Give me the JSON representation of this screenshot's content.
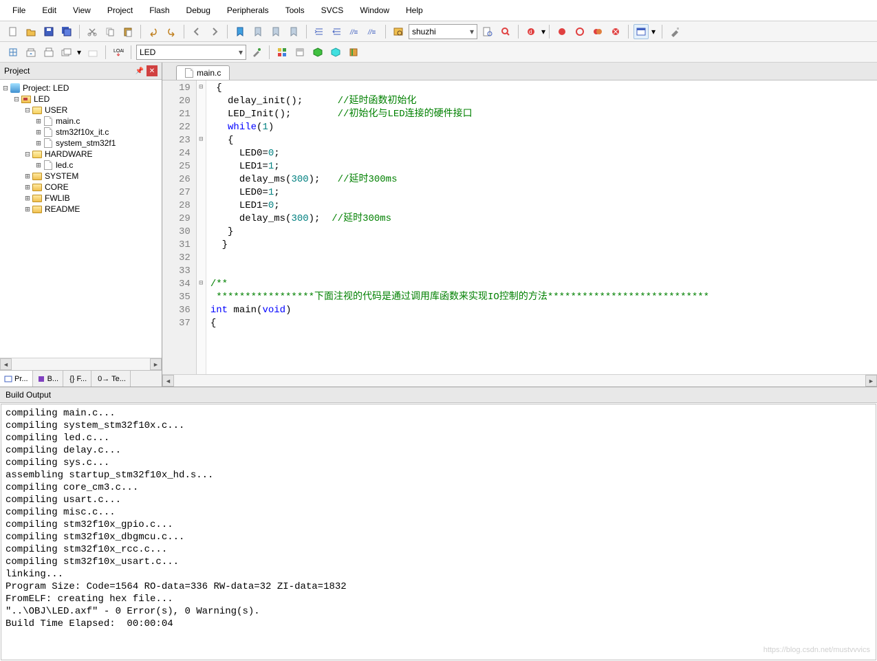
{
  "menu": [
    "File",
    "Edit",
    "View",
    "Project",
    "Flash",
    "Debug",
    "Peripherals",
    "Tools",
    "SVCS",
    "Window",
    "Help"
  ],
  "toolbar1": {
    "target_combo": "shuzhi"
  },
  "toolbar2": {
    "combo": "LED"
  },
  "project_panel": {
    "title": "Project",
    "root": "Project: LED",
    "target": "LED",
    "groups": [
      {
        "name": "USER",
        "files": [
          "main.c",
          "stm32f10x_it.c",
          "system_stm32f1"
        ],
        "expanded": true
      },
      {
        "name": "HARDWARE",
        "files": [
          "led.c"
        ],
        "expanded": true
      },
      {
        "name": "SYSTEM",
        "files": [],
        "expanded": false
      },
      {
        "name": "CORE",
        "files": [],
        "expanded": false
      },
      {
        "name": "FWLIB",
        "files": [],
        "expanded": false
      },
      {
        "name": "README",
        "files": [],
        "expanded": false
      }
    ],
    "bottom_tabs": [
      "Pr...",
      "B...",
      "{} F...",
      "0→ Te..."
    ]
  },
  "editor": {
    "tab": "main.c",
    "first_line": 19,
    "lines": [
      {
        "n": 19,
        "fold": "⊟",
        "tokens": [
          {
            "t": " {",
            "c": ""
          }
        ]
      },
      {
        "n": 20,
        "tokens": [
          {
            "t": "   delay_init();      ",
            "c": ""
          },
          {
            "t": "//延时函数初始化",
            "c": "comment"
          }
        ]
      },
      {
        "n": 21,
        "tokens": [
          {
            "t": "   LED_Init();        ",
            "c": ""
          },
          {
            "t": "//初始化与LED连接的硬件接口",
            "c": "comment"
          }
        ]
      },
      {
        "n": 22,
        "tokens": [
          {
            "t": "   ",
            "c": ""
          },
          {
            "t": "while",
            "c": "kw"
          },
          {
            "t": "(",
            "c": ""
          },
          {
            "t": "1",
            "c": "num"
          },
          {
            "t": ")",
            "c": ""
          }
        ]
      },
      {
        "n": 23,
        "fold": "⊟",
        "tokens": [
          {
            "t": "   {",
            "c": ""
          }
        ]
      },
      {
        "n": 24,
        "tokens": [
          {
            "t": "     LED0=",
            "c": ""
          },
          {
            "t": "0",
            "c": "num"
          },
          {
            "t": ";",
            "c": ""
          }
        ]
      },
      {
        "n": 25,
        "tokens": [
          {
            "t": "     LED1=",
            "c": ""
          },
          {
            "t": "1",
            "c": "num"
          },
          {
            "t": ";",
            "c": ""
          }
        ]
      },
      {
        "n": 26,
        "tokens": [
          {
            "t": "     delay_ms(",
            "c": ""
          },
          {
            "t": "300",
            "c": "num"
          },
          {
            "t": ");   ",
            "c": ""
          },
          {
            "t": "//延时300ms",
            "c": "comment"
          }
        ]
      },
      {
        "n": 27,
        "tokens": [
          {
            "t": "     LED0=",
            "c": ""
          },
          {
            "t": "1",
            "c": "num"
          },
          {
            "t": ";",
            "c": ""
          }
        ]
      },
      {
        "n": 28,
        "tokens": [
          {
            "t": "     LED1=",
            "c": ""
          },
          {
            "t": "0",
            "c": "num"
          },
          {
            "t": ";",
            "c": ""
          }
        ]
      },
      {
        "n": 29,
        "tokens": [
          {
            "t": "     delay_ms(",
            "c": ""
          },
          {
            "t": "300",
            "c": "num"
          },
          {
            "t": ");  ",
            "c": ""
          },
          {
            "t": "//延时300ms",
            "c": "comment"
          }
        ]
      },
      {
        "n": 30,
        "tokens": [
          {
            "t": "   }",
            "c": ""
          }
        ]
      },
      {
        "n": 31,
        "tokens": [
          {
            "t": "  }",
            "c": ""
          }
        ]
      },
      {
        "n": 32,
        "tokens": [
          {
            "t": " ",
            "c": ""
          }
        ]
      },
      {
        "n": 33,
        "tokens": [
          {
            "t": " ",
            "c": ""
          }
        ]
      },
      {
        "n": 34,
        "fold": "⊟",
        "tokens": [
          {
            "t": "/**",
            "c": "comment"
          }
        ]
      },
      {
        "n": 35,
        "tokens": [
          {
            "t": " *****************下面注视的代码是通过调用库函数来实现IO控制的方法****************************",
            "c": "comment"
          }
        ]
      },
      {
        "n": 36,
        "tokens": [
          {
            "t": "int",
            "c": "kw"
          },
          {
            "t": " main(",
            "c": ""
          },
          {
            "t": "void",
            "c": "kw"
          },
          {
            "t": ")",
            "c": ""
          }
        ]
      },
      {
        "n": 37,
        "tokens": [
          {
            "t": "{",
            "c": ""
          }
        ]
      }
    ]
  },
  "build": {
    "title": "Build Output",
    "lines": [
      "compiling main.c...",
      "compiling system_stm32f10x.c...",
      "compiling led.c...",
      "compiling delay.c...",
      "compiling sys.c...",
      "assembling startup_stm32f10x_hd.s...",
      "compiling core_cm3.c...",
      "compiling usart.c...",
      "compiling misc.c...",
      "compiling stm32f10x_gpio.c...",
      "compiling stm32f10x_dbgmcu.c...",
      "compiling stm32f10x_rcc.c...",
      "compiling stm32f10x_usart.c...",
      "linking...",
      "Program Size: Code=1564 RO-data=336 RW-data=32 ZI-data=1832",
      "FromELF: creating hex file...",
      "\"..\\OBJ\\LED.axf\" - 0 Error(s), 0 Warning(s).",
      "Build Time Elapsed:  00:00:04"
    ]
  },
  "watermark": "https://blog.csdn.net/mustvvvics"
}
